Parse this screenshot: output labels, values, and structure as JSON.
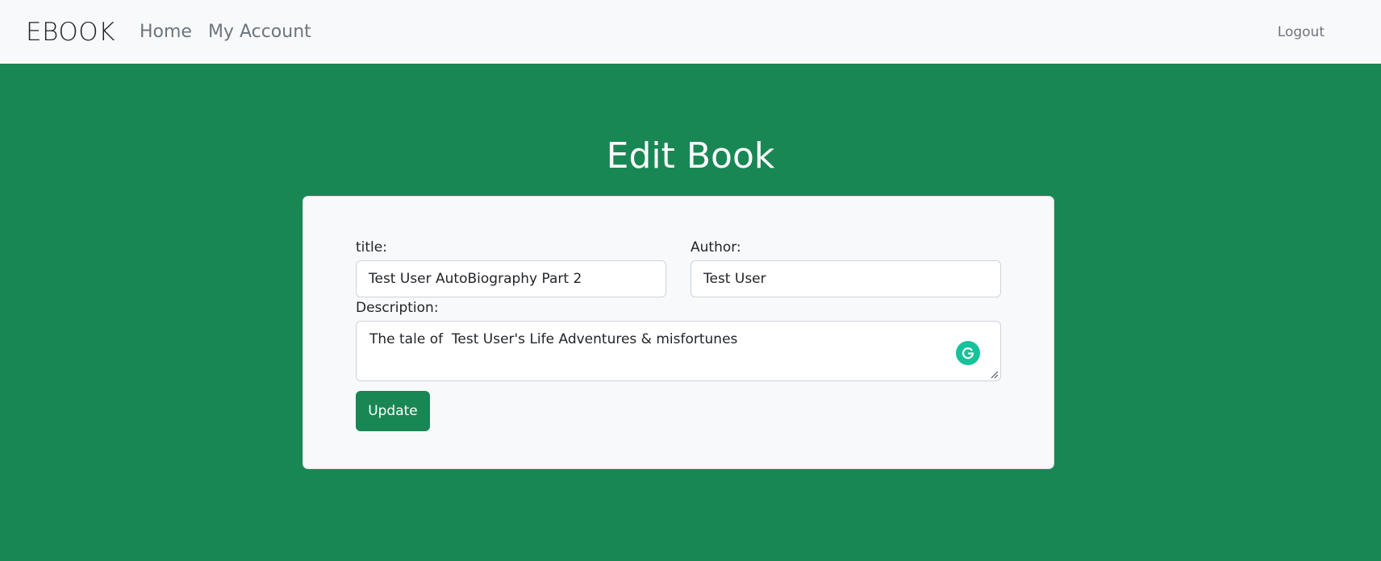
{
  "navbar": {
    "brand": "EBOOK",
    "links": [
      {
        "label": "Home"
      },
      {
        "label": "My Account"
      }
    ],
    "logout_label": "Logout"
  },
  "page": {
    "title": "Edit Book"
  },
  "form": {
    "title_label": "title:",
    "title_value": "Test User AutoBiography Part 2",
    "author_label": "Author:",
    "author_value": "Test User",
    "description_label": "Description:",
    "description_value": "The tale of  Test User's Life Adventures & misfortunes",
    "update_label": "Update"
  },
  "colors": {
    "background": "#198754",
    "card": "#f8f9fa",
    "button": "#198754",
    "grammarly": "#15c39a"
  },
  "icons": {
    "grammarly": "grammarly-g-icon",
    "resize": "resize-handle-icon"
  }
}
